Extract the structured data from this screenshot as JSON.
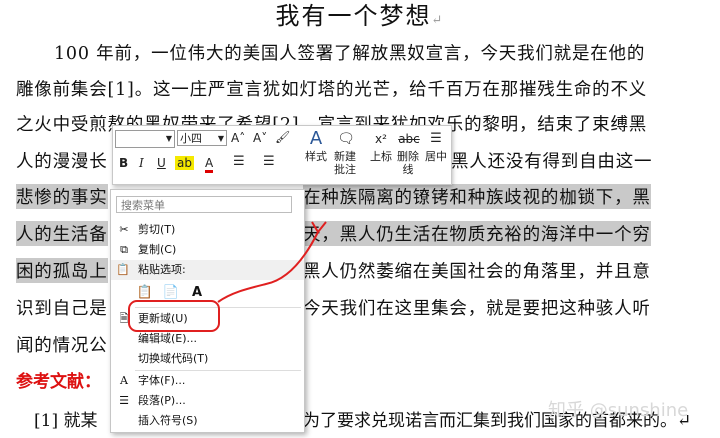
{
  "document": {
    "title": "我有一个梦想",
    "para_mark": "↵",
    "lines": [
      "100 年前，一位伟大的美国人签署了解放黑奴宣言，今天我们就是在他的",
      "雕像前集会[1]。这一庄严宣言犹如灯塔的光芒，给千百万在那摧残生命的不义",
      "之火中受煎熬的黑奴带来了希望[2]。宣言到来犹如欢乐的黎明，结束了束缚黑",
      "人的漫漫长",
      "悲惨的事实",
      "人的生活备",
      "困的孤岛上",
      "识到自己是",
      "闻的情况公"
    ],
    "line4_tail": "黑人还没有得到自由这一",
    "line5_tail": "在种族隔离的镣铐和种族歧视的枷锁下，黑",
    "line6_tail": "天，黑人仍生活在物质充裕的海洋中一个穷",
    "line7_tail": "黑人仍然萎缩在美国社会的角落里，并且意",
    "line8_tail": "今天我们在这里集会，就是要把这种骇人听",
    "references_heading": "参考文献：",
    "ref1_start": "[1]  就某",
    "ref1_tail": "为了要求兑现诺言而汇集到我们国家的首都来的。↵",
    "watermark": "知乎 @sunshine"
  },
  "mini_toolbar": {
    "font_value": "",
    "size_value": "小四",
    "grow_font": "A˄",
    "shrink_font": "A˅",
    "brush": "🖌",
    "styles_label": "样式",
    "new_comment_label": "新建批注",
    "superscript_label": "上标",
    "strikethrough_label": "删除线",
    "center_label": "居中",
    "bold": "B",
    "italic": "I",
    "underline": "U",
    "font_color": "A",
    "highlight": "ab"
  },
  "context_menu": {
    "search_placeholder": "搜索菜单",
    "items": {
      "cut": "剪切(T)",
      "copy": "复制(C)",
      "paste_options": "粘贴选项:",
      "update_field": "更新域(U)",
      "edit_field": "编辑域(E)...",
      "toggle_field_codes": "切换域代码(T)",
      "font": "字体(F)...",
      "paragraph": "段落(P)...",
      "insert_symbol": "插入符号(S)"
    }
  },
  "colors": {
    "annotation_red": "#e02020",
    "reference_heading": "#dd1111",
    "selection": "#c9c9c9"
  }
}
